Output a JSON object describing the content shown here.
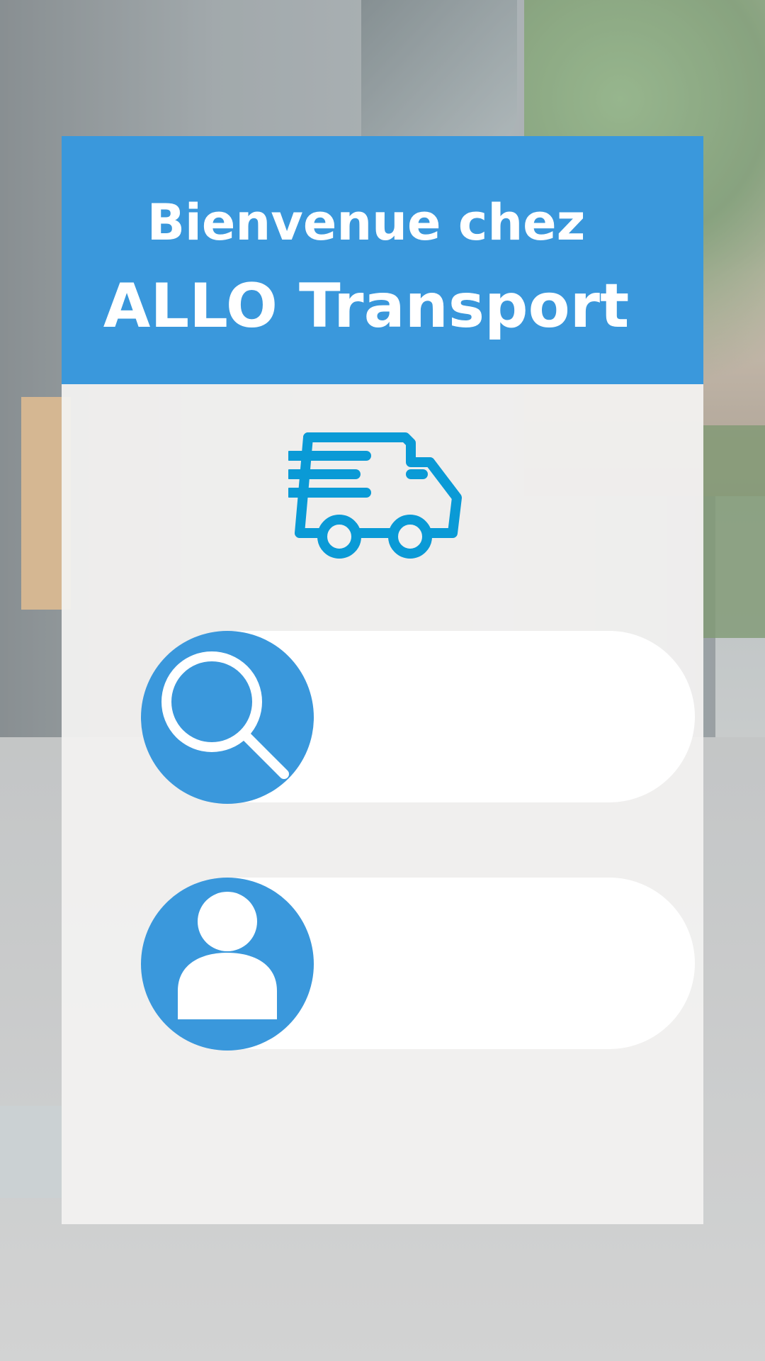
{
  "header": {
    "welcome": "Bienvenue chez",
    "brand": "ALLO Transport"
  },
  "icons": {
    "logo": "delivery-truck-icon",
    "search": "search-icon",
    "user": "user-icon"
  },
  "colors": {
    "primary": "#3a98dc",
    "truck": "#0a9ad6",
    "card": "#f2f1f0",
    "field": "#ffffff"
  },
  "fields": [
    {
      "icon": "search-icon",
      "value": ""
    },
    {
      "icon": "user-icon",
      "value": ""
    }
  ]
}
